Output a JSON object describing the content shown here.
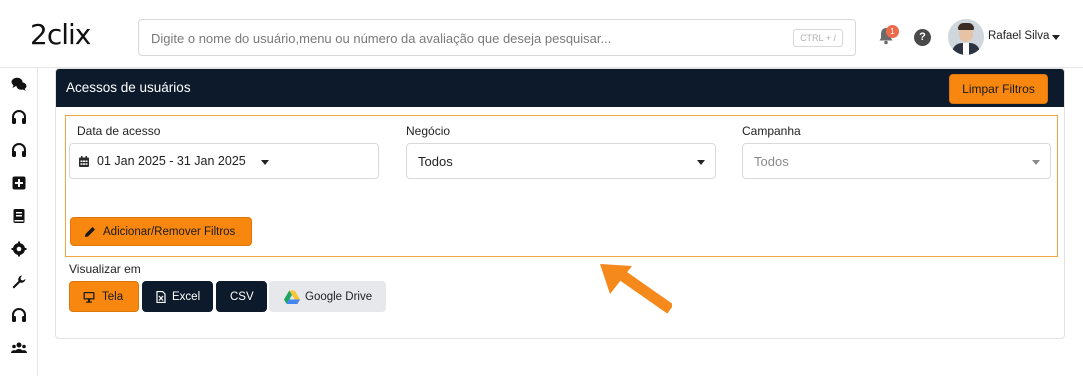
{
  "header": {
    "logo_text": "2clix",
    "search_placeholder": "Digite o nome do usuário,menu ou número da avaliação que deseja pesquisar...",
    "search_shortcut": "CTRL + /",
    "notification_count": "1",
    "help_label": "?",
    "user_name": "Rafael Silva"
  },
  "sidebar": {
    "icons": [
      "comments-icon",
      "headset-icon",
      "headset-icon",
      "plus-square-icon",
      "book-icon",
      "cog-icon",
      "wrench-icon",
      "headset-icon",
      "users-icon"
    ]
  },
  "panel": {
    "title": "Acessos de usuários",
    "clear_filters_label": "Limpar Filtros"
  },
  "filters": {
    "date_label": "Data de acesso",
    "date_value": "01 Jan 2025 - 31 Jan 2025",
    "business_label": "Negócio",
    "business_value": "Todos",
    "campaign_label": "Campanha",
    "campaign_value": "Todos",
    "add_remove_label": "Adicionar/Remover Filtros"
  },
  "view": {
    "label": "Visualizar em",
    "buttons": {
      "tela": "Tela",
      "excel": "Excel",
      "csv": "CSV",
      "drive": "Google Drive"
    }
  },
  "colors": {
    "accent": "#f7870f",
    "header_dark": "#0d1a2b",
    "filter_border": "#f3a640"
  }
}
